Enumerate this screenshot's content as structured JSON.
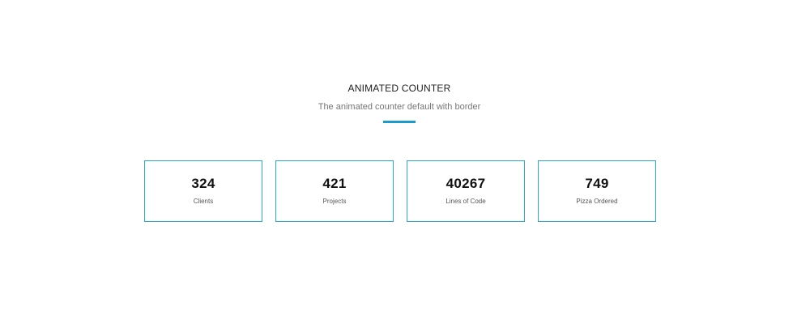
{
  "section": {
    "title": "ANIMATED COUNTER",
    "subtitle": "The animated counter default with border",
    "accent_color": "#1a9bcb",
    "border_color": "#29abd6"
  },
  "counters": [
    {
      "value": "324",
      "label": "Clients"
    },
    {
      "value": "421",
      "label": "Projects"
    },
    {
      "value": "40267",
      "label": "Lines of Code"
    },
    {
      "value": "749",
      "label": "Pizza Ordered"
    }
  ]
}
